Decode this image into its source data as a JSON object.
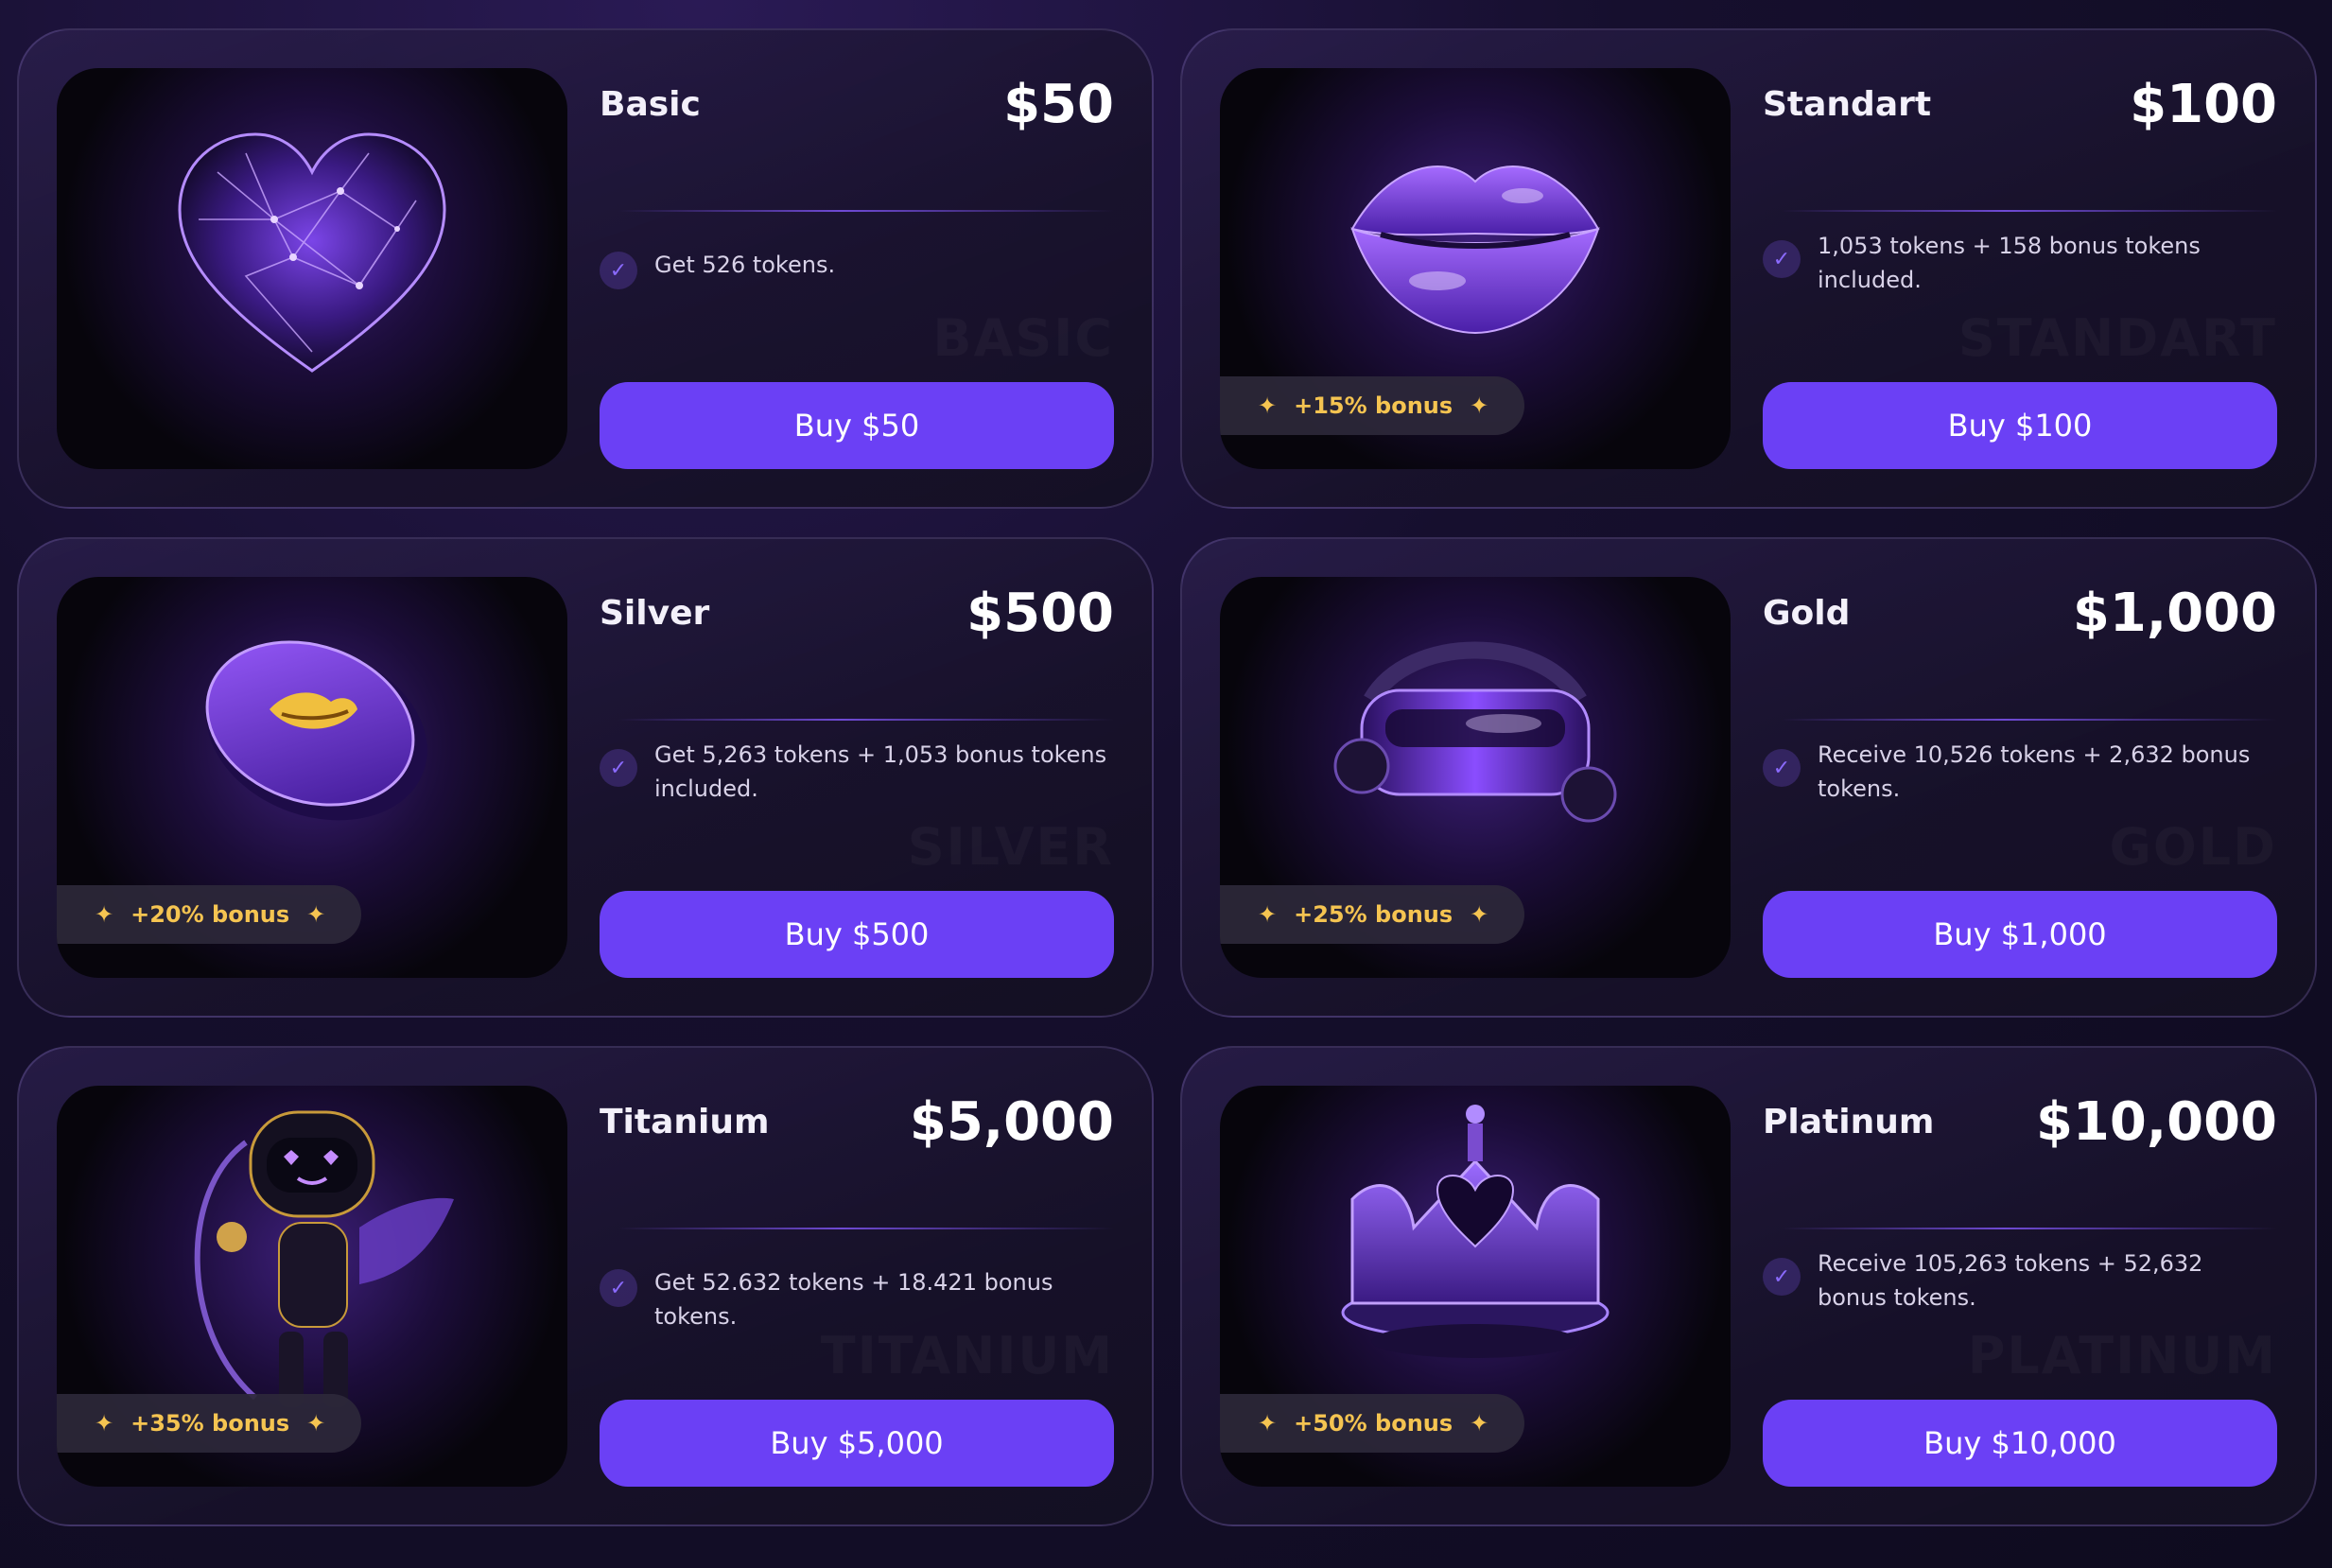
{
  "colors": {
    "accent": "#6b40f5",
    "bonus": "#f5c451",
    "background": "#160f2e"
  },
  "plans": [
    {
      "name": "Basic",
      "price": "$50",
      "feature": "Get 526 tokens.",
      "watermark": "BASIC",
      "button": "Buy $50",
      "bonus": "",
      "icon": "crystal-heart-icon"
    },
    {
      "name": "Standart",
      "price": "$100",
      "feature": "1,053 tokens + 158 bonus tokens included.",
      "watermark": "STANDART",
      "button": "Buy $100",
      "bonus": "+15% bonus",
      "icon": "purple-lips-icon"
    },
    {
      "name": "Silver",
      "price": "$500",
      "feature": "Get 5,263 tokens + 1,053 bonus tokens included.",
      "watermark": "SILVER",
      "button": "Buy $500",
      "bonus": "+20% bonus",
      "icon": "lips-coin-icon"
    },
    {
      "name": "Gold",
      "price": "$1,000",
      "feature": "Receive 10,526 tokens + 2,632 bonus tokens.",
      "watermark": "GOLD",
      "button": "Buy $1,000",
      "bonus": "+25% bonus",
      "icon": "vr-headset-icon"
    },
    {
      "name": "Titanium",
      "price": "$5,000",
      "feature": "Get 52.632 tokens + 18.421 bonus tokens.",
      "watermark": "TITANIUM",
      "button": "Buy $5,000",
      "bonus": "+35% bonus",
      "icon": "cupid-robot-icon"
    },
    {
      "name": "Platinum",
      "price": "$10,000",
      "feature": "Receive 105,263 tokens + 52,632 bonus tokens.",
      "watermark": "PLATINUM",
      "button": "Buy $10,000",
      "bonus": "+50% bonus",
      "icon": "heart-crown-icon"
    }
  ]
}
